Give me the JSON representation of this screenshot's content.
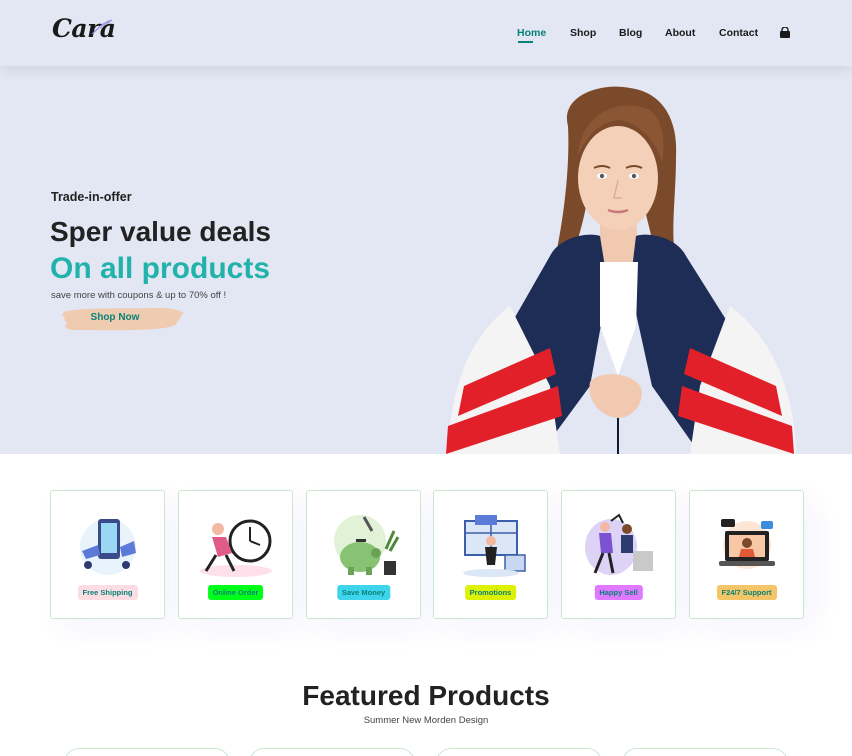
{
  "header": {
    "logo_text": "Cara",
    "nav": [
      {
        "label": "Home",
        "active": true
      },
      {
        "label": "Shop",
        "active": false
      },
      {
        "label": "Blog",
        "active": false
      },
      {
        "label": "About",
        "active": false
      },
      {
        "label": "Contact",
        "active": false
      }
    ],
    "cart_icon": "shopping-bag-icon"
  },
  "hero": {
    "kicker": "Trade-in-offer",
    "headline": "Sper value deals",
    "highlight": "On all products",
    "tagline": "save more with coupons & up to 70% off !",
    "button_label": "Shop Now"
  },
  "features": [
    {
      "label": "Free Shipping",
      "bg": "#fddde4",
      "illustration": "phone-delivery-illustration"
    },
    {
      "label": "Online Order",
      "bg": "#00ff19",
      "illustration": "clock-runner-illustration"
    },
    {
      "label": "Save Money",
      "bg": "#3ed5ec",
      "illustration": "piggy-bank-illustration"
    },
    {
      "label": "Promotions",
      "bg": "#dcf105",
      "illustration": "promotion-illustration"
    },
    {
      "label": "Happy Sell",
      "bg": "#e079ff",
      "illustration": "high-five-illustration"
    },
    {
      "label": "F24/7 Support",
      "bg": "#f3c566",
      "illustration": "laptop-support-illustration"
    }
  ],
  "featured": {
    "title": "Featured Products",
    "subtitle": "Summer New Morden Design"
  },
  "colors": {
    "accent": "#088178",
    "headline_highlight": "#21b3ab",
    "header_bg": "#e3e6f3"
  }
}
